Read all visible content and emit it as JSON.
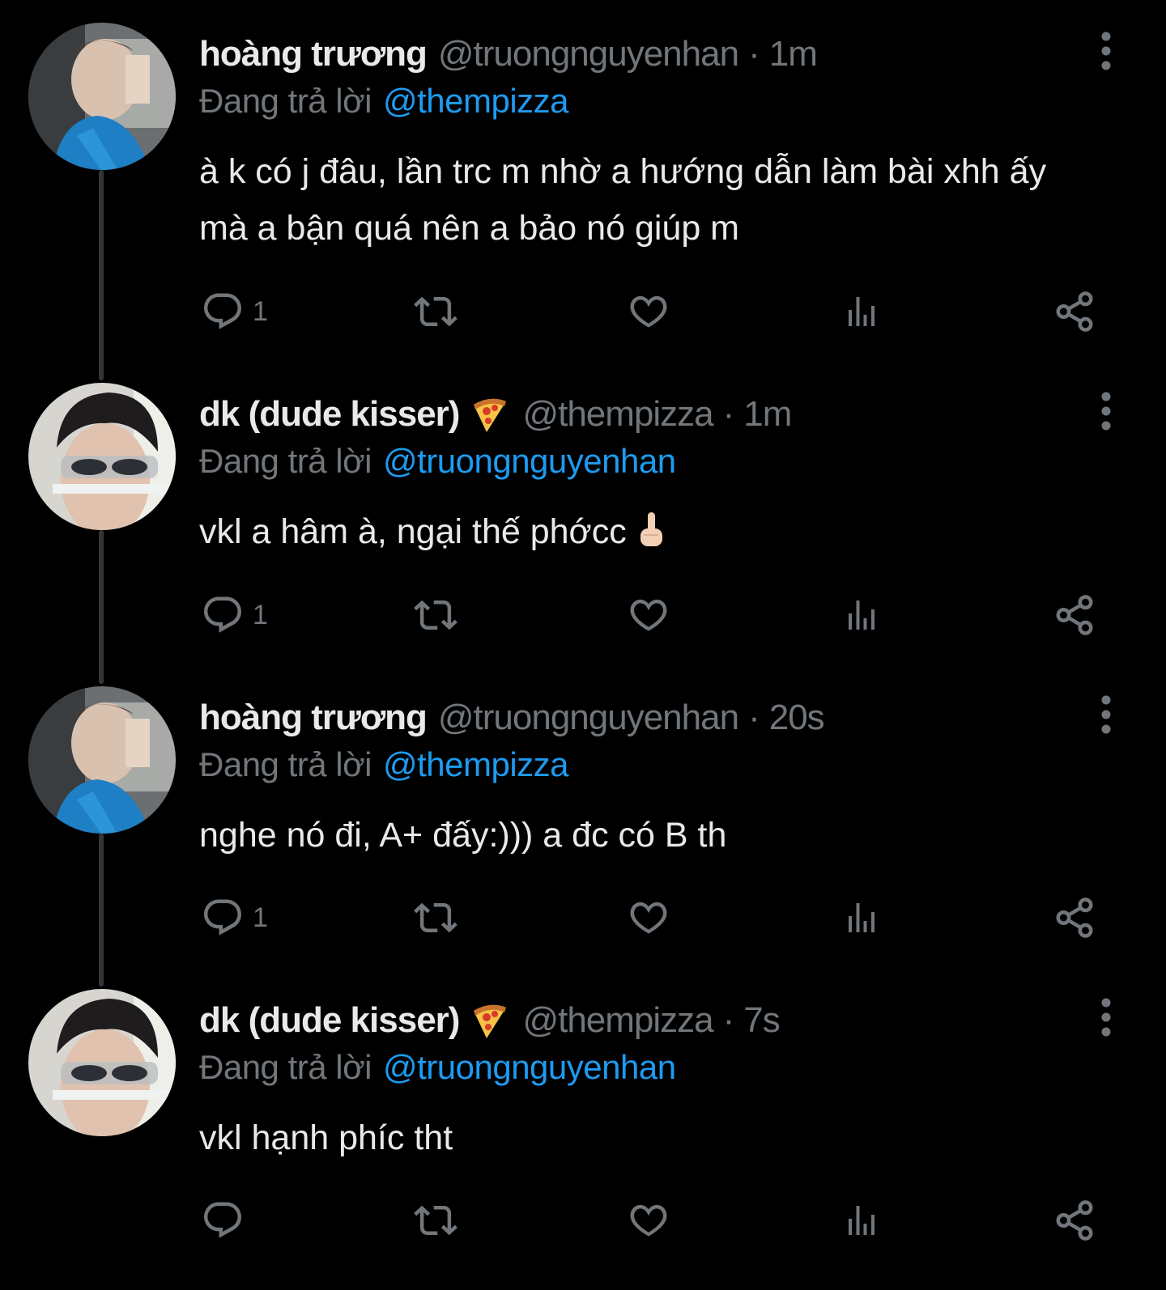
{
  "tweets": [
    {
      "display_name": "hoàng trương",
      "name_emoji": "",
      "handle": "@truongnguyenhan",
      "separator": "·",
      "time": "1m",
      "reply_prefix": "Đang trả lời",
      "reply_to": "@thempizza",
      "text_lines": [
        "à k có j đâu, lần trc m nhờ a hướng dẫn làm bài xhh ấy",
        "mà a bận quá nên a bảo nó giúp m"
      ],
      "text_emoji": "",
      "reply_count": "1",
      "avatar": "avatar-a"
    },
    {
      "display_name": "dk (dude kisser)",
      "name_emoji": "pizza-emoji",
      "handle": "@thempizza",
      "separator": "·",
      "time": "1m",
      "reply_prefix": "Đang trả lời",
      "reply_to": "@truongnguyenhan",
      "text_lines": [
        "vkl a hâm à, ngại thế phớcc"
      ],
      "text_emoji": "middle-finger-emoji",
      "reply_count": "1",
      "avatar": "avatar-b"
    },
    {
      "display_name": "hoàng trương",
      "name_emoji": "",
      "handle": "@truongnguyenhan",
      "separator": "·",
      "time": "20s",
      "reply_prefix": "Đang trả lời",
      "reply_to": "@thempizza",
      "text_lines": [
        "nghe nó đi, A+ đấy:))) a đc có B th"
      ],
      "text_emoji": "",
      "reply_count": "1",
      "avatar": "avatar-a"
    },
    {
      "display_name": "dk (dude kisser)",
      "name_emoji": "pizza-emoji",
      "handle": "@thempizza",
      "separator": "·",
      "time": "7s",
      "reply_prefix": "Đang trả lời",
      "reply_to": "@truongnguyenhan",
      "text_lines": [
        "vkl hạnh phíc tht"
      ],
      "text_emoji": "",
      "reply_count": "",
      "avatar": "avatar-b"
    }
  ],
  "icons": {
    "reply": "reply-icon",
    "retweet": "retweet-icon",
    "like": "heart-icon",
    "views": "views-icon",
    "share": "share-icon",
    "more": "more-vertical-icon"
  },
  "colors": {
    "background": "#000000",
    "text": "#e7e9ea",
    "secondary": "#71767b",
    "link": "#1d9bf0",
    "thread_line": "#333639"
  }
}
